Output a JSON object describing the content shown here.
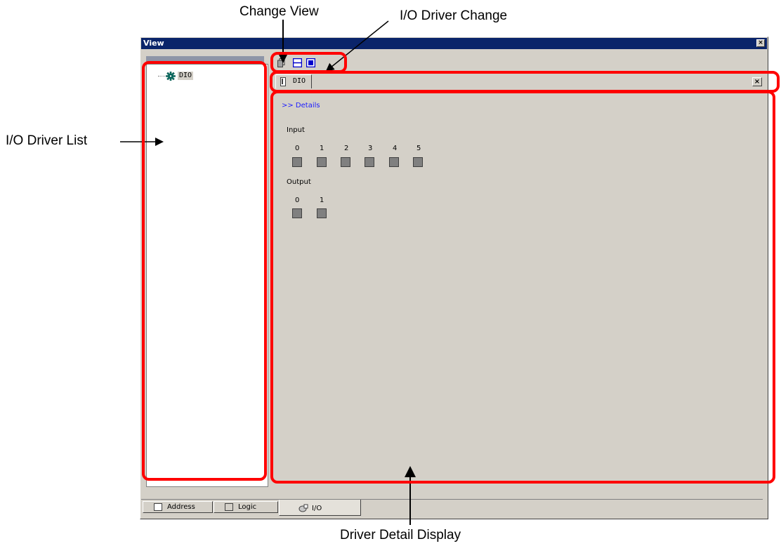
{
  "callouts": {
    "change_view": "Change View",
    "io_driver_change": "I/O Driver Change",
    "io_driver_list": "I/O Driver List",
    "driver_detail_display": "Driver Detail Display"
  },
  "window": {
    "title": "View",
    "close_glyph": "×"
  },
  "tree": {
    "items": [
      {
        "label": "DIO",
        "icon": "driver-gear-icon"
      }
    ]
  },
  "toolbar": {
    "icons": [
      "copy-view-icon",
      "split-horizontal-icon",
      "maximize-view-icon"
    ]
  },
  "driver_tab": {
    "label": "DIO",
    "icon": "driver-tab-icon",
    "close_glyph": "×"
  },
  "details": {
    "link": ">> Details",
    "input_label": "Input",
    "input_bits": [
      "0",
      "1",
      "2",
      "3",
      "4",
      "5"
    ],
    "output_label": "Output",
    "output_bits": [
      "0",
      "1"
    ]
  },
  "bottom_tabs": [
    {
      "label": "Address",
      "icon": "address-icon",
      "selected": false
    },
    {
      "label": "Logic",
      "icon": "logic-icon",
      "selected": false
    },
    {
      "label": "I/O",
      "icon": "io-icon",
      "selected": true
    }
  ],
  "colors": {
    "highlight": "#ff0000",
    "titlebar": "#0a246a",
    "panel": "#d4d0c8"
  }
}
